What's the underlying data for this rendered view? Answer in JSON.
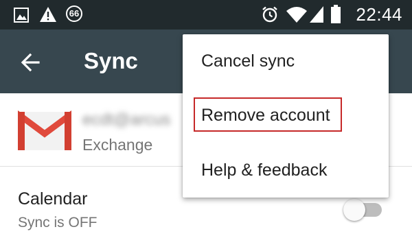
{
  "status_bar": {
    "time": "22:44",
    "notification_count": "66",
    "icons": [
      "image-icon",
      "warning-icon",
      "notification-count-badge",
      "alarm-icon",
      "wifi-icon",
      "signal-icon",
      "battery-icon"
    ]
  },
  "app_bar": {
    "title": "Sync",
    "back_icon": "arrow-back-icon",
    "color": "#37474f"
  },
  "account": {
    "email": "ecdt@arcus",
    "type": "Exchange",
    "logo_icon": "gmail-icon"
  },
  "sync_items": [
    {
      "label": "Calendar",
      "status": "Sync is OFF",
      "enabled": false
    }
  ],
  "overflow_menu": {
    "items": [
      {
        "label": "Cancel sync"
      },
      {
        "label": "Remove account",
        "highlighted": true
      },
      {
        "label": "Help & feedback"
      }
    ],
    "highlight_color": "#c62828"
  }
}
